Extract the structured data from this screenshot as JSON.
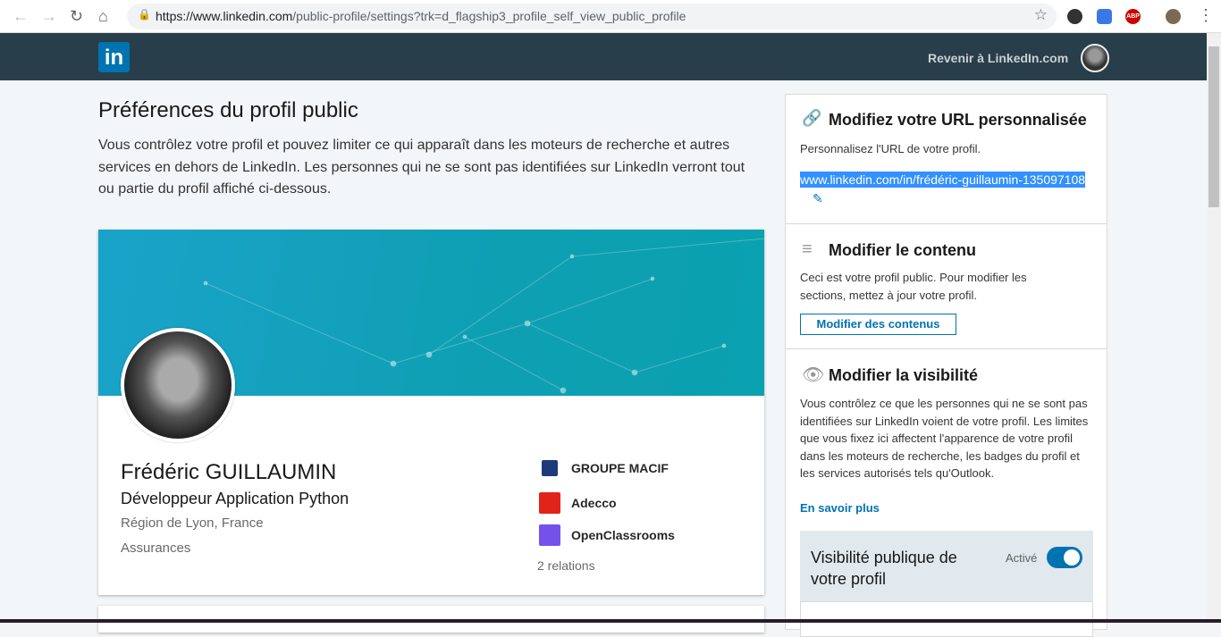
{
  "browser": {
    "url_host": "https://www.linkedin.com",
    "url_path": "/public-profile/settings?trk=d_flagship3_profile_self_view_public_profile",
    "ext_abp": "ABP"
  },
  "header": {
    "logo": "in",
    "back_link": "Revenir à LinkedIn.com"
  },
  "page": {
    "title": "Préférences du profil public",
    "description": "Vous contrôlez votre profil et pouvez limiter ce qui apparaît dans les moteurs de recherche et autres services en dehors de LinkedIn. Les personnes qui ne se sont pas identifiées sur LinkedIn verront tout ou partie du profil affiché ci-dessous."
  },
  "profile": {
    "name": "Frédéric GUILLAUMIN",
    "headline": "Développeur Application Python",
    "location": "Région de Lyon, France",
    "industry": "Assurances",
    "companies": [
      {
        "name": "GROUPE MACIF",
        "color": "#1d3a7a"
      },
      {
        "name": "Adecco",
        "color": "#e2231a"
      },
      {
        "name": "OpenClassrooms",
        "color": "#7451eb"
      }
    ],
    "relations": "2 relations"
  },
  "sidebar": {
    "url_section": {
      "title": "Modifiez votre URL personnalisée",
      "text": "Personnalisez l'URL de votre profil.",
      "url": "www.linkedin.com/in/frédéric-guillaumin-135097108"
    },
    "content_section": {
      "title": "Modifier le contenu",
      "text": "Ceci est votre profil public. Pour modifier les sections, mettez à jour votre profil.",
      "button": "Modifier des contenus"
    },
    "visibility_section": {
      "title": "Modifier la visibilité",
      "text": "Vous contrôlez ce que les personnes qui ne se sont pas identifiées sur LinkedIn voient de votre profil. Les limites que vous fixez ici affectent l'apparence de votre profil dans les moteurs de recherche, les badges du profil et les services autorisés tels qu'Outlook.",
      "link": "En savoir plus",
      "toggle_title": "Visibilité publique de votre profil",
      "toggle_label": "Activé",
      "toggle_on": true
    }
  }
}
